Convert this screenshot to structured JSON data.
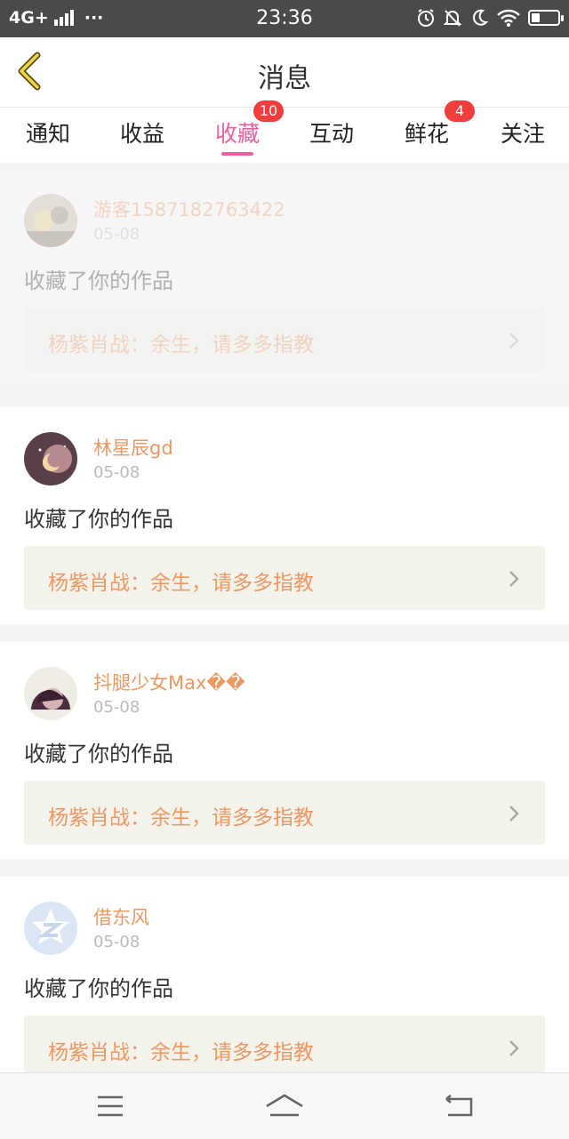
{
  "status_bar": {
    "network": "4G+",
    "dots": "···",
    "time": "23:36",
    "icons": [
      "alarm-icon",
      "mute-bell-icon",
      "moon-icon",
      "wifi-icon",
      "battery-icon"
    ]
  },
  "header": {
    "title": "消息",
    "back_icon": "chevron-left-icon"
  },
  "tabs": [
    {
      "label": "通知",
      "badge": null,
      "active": false
    },
    {
      "label": "收益",
      "badge": null,
      "active": false
    },
    {
      "label": "收藏",
      "badge": "10",
      "active": true
    },
    {
      "label": "互动",
      "badge": null,
      "active": false
    },
    {
      "label": "鲜花",
      "badge": "4",
      "active": false
    },
    {
      "label": "关注",
      "badge": null,
      "active": false
    }
  ],
  "messages": [
    {
      "name": "游客1587182763422",
      "date": "05-08",
      "action": "收藏了你的作品",
      "work": "杨紫肖战：余生，请多多指教"
    },
    {
      "name": "林星辰gd",
      "date": "05-08",
      "action": "收藏了你的作品",
      "work": "杨紫肖战：余生，请多多指教"
    },
    {
      "name": "抖腿少女Max��",
      "date": "05-08",
      "action": "收藏了你的作品",
      "work": "杨紫肖战：余生，请多多指教"
    },
    {
      "name": "借东风",
      "date": "05-08",
      "action": "收藏了你的作品",
      "work": "杨紫肖战：余生，请多多指教"
    }
  ],
  "colors": {
    "accent": "#e8629f",
    "badge": "#f23d3d",
    "username": "#ec9863",
    "work_bg": "#f3f3ec"
  },
  "nav": [
    "menu-icon",
    "home-icon",
    "back-icon"
  ]
}
